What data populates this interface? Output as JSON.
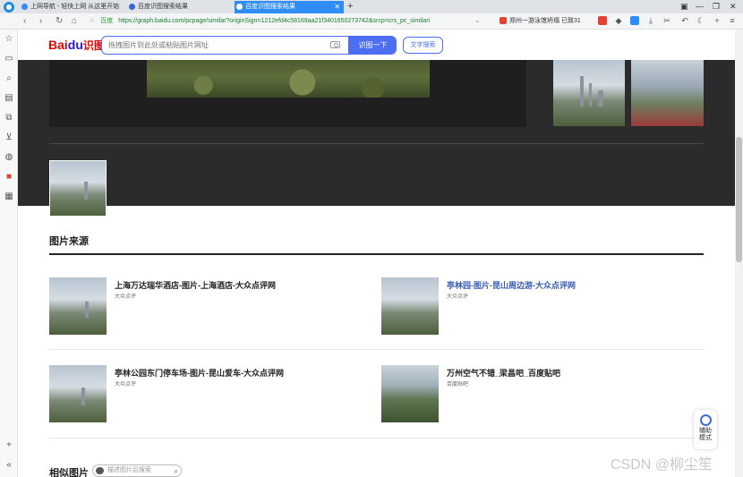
{
  "tabs": [
    {
      "label": "上网导航 - 轻快上网 从这里开始"
    },
    {
      "label": "百度识图搜索结果"
    },
    {
      "label": "百度识图搜索结果",
      "active": true
    }
  ],
  "address_bar": {
    "security_label": "百度",
    "url": "https://graph.baidu.com/pcpage/similar?originSign=1212efd4c58169aa21f3401650273742&srcp=crs_pc_similari",
    "news_tip": "郑州一游泳馆坍塌 已致31"
  },
  "header": {
    "logo_part1": "Bai",
    "logo_part2": "du",
    "logo_part3": "识图",
    "search_placeholder": "拖拽图片到此处或粘贴图片网址",
    "search_button": "识图一下",
    "text_search_button": "文字搜索"
  },
  "sections": {
    "source_title": "图片来源",
    "similar_title": "相似图片",
    "similar_search_placeholder": "描述图片后搜索"
  },
  "sources": [
    {
      "title": "上海万达瑞华酒店-图片-上海酒店-大众点评网",
      "site": "大众点评",
      "link_style": false
    },
    {
      "title": "亭林园-图片-昆山周边游-大众点评网",
      "site": "大众点评",
      "link_style": true
    },
    {
      "title": "亭林公园东门停车场-图片-昆山爱车-大众点评网",
      "site": "大众点评",
      "link_style": false
    },
    {
      "title": "万州空气不错_梁昌吧_百度贴吧",
      "site": "百度贴吧",
      "link_style": false
    }
  ],
  "assist": {
    "line1": "辅助",
    "line2": "模式"
  },
  "watermark": "CSDN @柳尘笙",
  "colors": {
    "accent": "#4e6ef2",
    "tab_active": "#2f8df5",
    "dark_panel": "#2b2b2b",
    "link": "#3b5db3"
  }
}
